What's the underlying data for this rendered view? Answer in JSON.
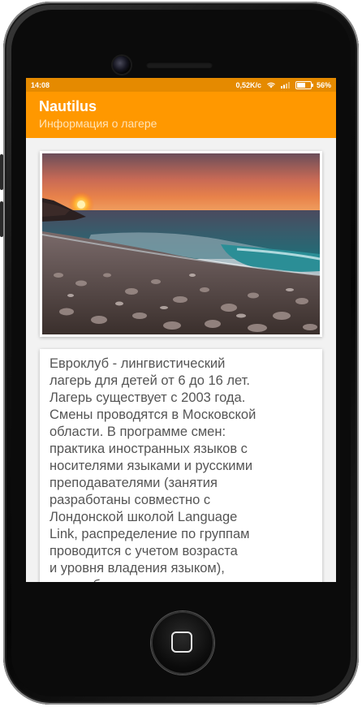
{
  "status_bar": {
    "time": "14:08",
    "speed": "0,52K/c",
    "battery": "56%",
    "battery_level": 0.56,
    "icons": [
      "wifi-icon",
      "signal-icon",
      "battery-icon"
    ]
  },
  "app_bar": {
    "title": "Nautilus",
    "subtitle": "Информация о лагере"
  },
  "image": {
    "description_icon": "camp-photo"
  },
  "description": "Евроклуб - лингвистический\nлагерь для детей от 6 до 16 лет.\nЛагерь существует с 2003 года.\nСмены проводятся в Московской\nобласти. В программе смен:\nпрактика иностранных языков с\nносителями языками и русскими\nпреподавателями (занятия\nразработаны совместно с\nЛондонской школой Language\nLink, распределение по группам\nпроводится с учетом возраста\nи уровня владения языком),\nразнообразные шоу-программы,",
  "colors": {
    "status_bar": "#e58a00",
    "app_bar": "#ff9800"
  }
}
